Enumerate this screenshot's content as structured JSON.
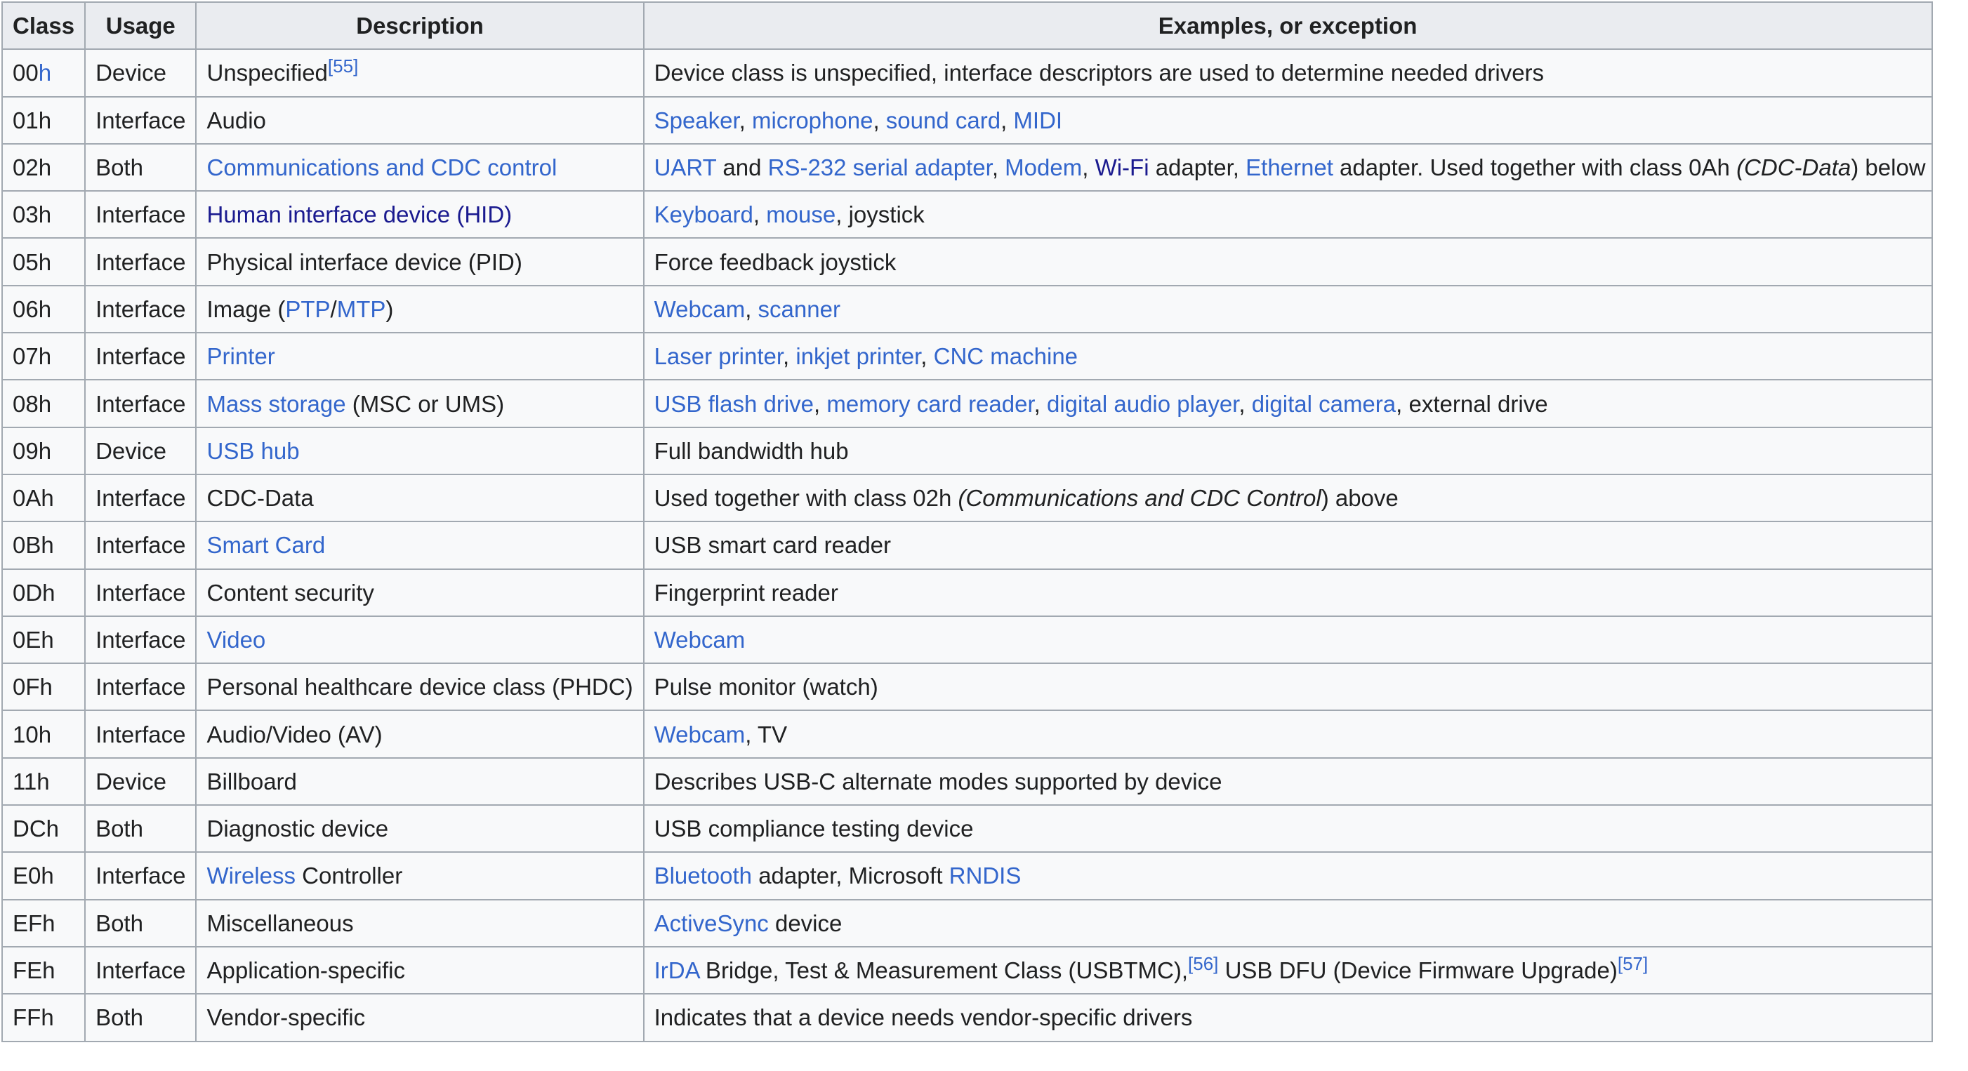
{
  "table": {
    "headers": [
      "Class",
      "Usage",
      "Description",
      "Examples, or exception"
    ],
    "rows": [
      {
        "class": [
          {
            "t": "00"
          },
          {
            "t": "h",
            "link": true
          }
        ],
        "usage": [
          {
            "t": "Device"
          }
        ],
        "description": [
          {
            "t": "Unspecified"
          },
          {
            "t": "[55]",
            "sup": true,
            "link": true
          }
        ],
        "examples": [
          {
            "t": "Device class is unspecified, interface descriptors are used to determine needed drivers"
          }
        ]
      },
      {
        "class": [
          {
            "t": "01h"
          }
        ],
        "usage": [
          {
            "t": "Interface"
          }
        ],
        "description": [
          {
            "t": "Audio"
          }
        ],
        "examples": [
          {
            "t": "Speaker",
            "link": true
          },
          {
            "t": ", "
          },
          {
            "t": "microphone",
            "link": true
          },
          {
            "t": ", "
          },
          {
            "t": "sound card",
            "link": true
          },
          {
            "t": ", "
          },
          {
            "t": "MIDI",
            "link": true
          }
        ]
      },
      {
        "class": [
          {
            "t": "02h"
          }
        ],
        "usage": [
          {
            "t": "Both"
          }
        ],
        "description": [
          {
            "t": "Communications and CDC control",
            "link": true
          }
        ],
        "examples": [
          {
            "t": "UART",
            "link": true
          },
          {
            "t": " and "
          },
          {
            "t": "RS-232 serial adapter",
            "link": true
          },
          {
            "t": ", "
          },
          {
            "t": "Modem",
            "link": true
          },
          {
            "t": ", "
          },
          {
            "t": "Wi-Fi",
            "link": true,
            "visited": true
          },
          {
            "t": " adapter, "
          },
          {
            "t": "Ethernet",
            "link": true
          },
          {
            "t": " adapter. Used together with class 0Ah "
          },
          {
            "t": "(CDC-Data",
            "italic": true
          },
          {
            "t": ") below"
          }
        ]
      },
      {
        "class": [
          {
            "t": "03h"
          }
        ],
        "usage": [
          {
            "t": "Interface"
          }
        ],
        "description": [
          {
            "t": "Human interface device (HID)",
            "link": true,
            "visited": true
          }
        ],
        "examples": [
          {
            "t": "Keyboard",
            "link": true
          },
          {
            "t": ", "
          },
          {
            "t": "mouse",
            "link": true
          },
          {
            "t": ", joystick"
          }
        ]
      },
      {
        "class": [
          {
            "t": "05h"
          }
        ],
        "usage": [
          {
            "t": "Interface"
          }
        ],
        "description": [
          {
            "t": "Physical interface device (PID)"
          }
        ],
        "examples": [
          {
            "t": "Force feedback joystick"
          }
        ]
      },
      {
        "class": [
          {
            "t": "06h"
          }
        ],
        "usage": [
          {
            "t": "Interface"
          }
        ],
        "description": [
          {
            "t": "Image ("
          },
          {
            "t": "PTP",
            "link": true
          },
          {
            "t": "/"
          },
          {
            "t": "MTP",
            "link": true
          },
          {
            "t": ")"
          }
        ],
        "examples": [
          {
            "t": "Webcam",
            "link": true
          },
          {
            "t": ", "
          },
          {
            "t": "scanner",
            "link": true
          }
        ]
      },
      {
        "class": [
          {
            "t": "07h"
          }
        ],
        "usage": [
          {
            "t": "Interface"
          }
        ],
        "description": [
          {
            "t": "Printer",
            "link": true
          }
        ],
        "examples": [
          {
            "t": "Laser printer",
            "link": true
          },
          {
            "t": ", "
          },
          {
            "t": "inkjet printer",
            "link": true
          },
          {
            "t": ", "
          },
          {
            "t": "CNC machine",
            "link": true
          }
        ]
      },
      {
        "class": [
          {
            "t": "08h"
          }
        ],
        "usage": [
          {
            "t": "Interface"
          }
        ],
        "description": [
          {
            "t": "Mass storage",
            "link": true
          },
          {
            "t": " (MSC or UMS)"
          }
        ],
        "examples": [
          {
            "t": "USB flash drive",
            "link": true
          },
          {
            "t": ", "
          },
          {
            "t": "memory card reader",
            "link": true
          },
          {
            "t": ", "
          },
          {
            "t": "digital audio player",
            "link": true
          },
          {
            "t": ", "
          },
          {
            "t": "digital camera",
            "link": true
          },
          {
            "t": ", external drive"
          }
        ]
      },
      {
        "class": [
          {
            "t": "09h"
          }
        ],
        "usage": [
          {
            "t": "Device"
          }
        ],
        "description": [
          {
            "t": "USB hub",
            "link": true
          }
        ],
        "examples": [
          {
            "t": "Full bandwidth hub"
          }
        ]
      },
      {
        "class": [
          {
            "t": "0Ah"
          }
        ],
        "usage": [
          {
            "t": "Interface"
          }
        ],
        "description": [
          {
            "t": "CDC-Data"
          }
        ],
        "examples": [
          {
            "t": "Used together with class 02h "
          },
          {
            "t": "(Communications and CDC Control",
            "italic": true
          },
          {
            "t": ") above"
          }
        ]
      },
      {
        "class": [
          {
            "t": "0Bh"
          }
        ],
        "usage": [
          {
            "t": "Interface"
          }
        ],
        "description": [
          {
            "t": "Smart Card",
            "link": true
          }
        ],
        "examples": [
          {
            "t": "USB smart card reader"
          }
        ]
      },
      {
        "class": [
          {
            "t": "0Dh"
          }
        ],
        "usage": [
          {
            "t": "Interface"
          }
        ],
        "description": [
          {
            "t": "Content security"
          }
        ],
        "examples": [
          {
            "t": "Fingerprint reader"
          }
        ]
      },
      {
        "class": [
          {
            "t": "0Eh"
          }
        ],
        "usage": [
          {
            "t": "Interface"
          }
        ],
        "description": [
          {
            "t": "Video",
            "link": true
          }
        ],
        "examples": [
          {
            "t": "Webcam",
            "link": true
          }
        ]
      },
      {
        "class": [
          {
            "t": "0Fh"
          }
        ],
        "usage": [
          {
            "t": "Interface"
          }
        ],
        "description": [
          {
            "t": "Personal healthcare device class (PHDC)"
          }
        ],
        "examples": [
          {
            "t": "Pulse monitor (watch)"
          }
        ]
      },
      {
        "class": [
          {
            "t": "10h"
          }
        ],
        "usage": [
          {
            "t": "Interface"
          }
        ],
        "description": [
          {
            "t": "Audio/Video (AV)"
          }
        ],
        "examples": [
          {
            "t": "Webcam",
            "link": true
          },
          {
            "t": ", TV"
          }
        ]
      },
      {
        "class": [
          {
            "t": "11h"
          }
        ],
        "usage": [
          {
            "t": "Device"
          }
        ],
        "description": [
          {
            "t": "Billboard"
          }
        ],
        "examples": [
          {
            "t": "Describes USB-C alternate modes supported by device"
          }
        ]
      },
      {
        "class": [
          {
            "t": "DCh"
          }
        ],
        "usage": [
          {
            "t": "Both"
          }
        ],
        "description": [
          {
            "t": "Diagnostic device"
          }
        ],
        "examples": [
          {
            "t": "USB compliance testing device"
          }
        ]
      },
      {
        "class": [
          {
            "t": "E0h"
          }
        ],
        "usage": [
          {
            "t": "Interface"
          }
        ],
        "description": [
          {
            "t": "Wireless",
            "link": true
          },
          {
            "t": " Controller"
          }
        ],
        "examples": [
          {
            "t": "Bluetooth",
            "link": true
          },
          {
            "t": " adapter, Microsoft "
          },
          {
            "t": "RNDIS",
            "link": true
          }
        ]
      },
      {
        "class": [
          {
            "t": "EFh"
          }
        ],
        "usage": [
          {
            "t": "Both"
          }
        ],
        "description": [
          {
            "t": "Miscellaneous"
          }
        ],
        "examples": [
          {
            "t": "ActiveSync",
            "link": true
          },
          {
            "t": " device"
          }
        ]
      },
      {
        "class": [
          {
            "t": "FEh"
          }
        ],
        "usage": [
          {
            "t": "Interface"
          }
        ],
        "description": [
          {
            "t": "Application-specific"
          }
        ],
        "examples": [
          {
            "t": "IrDA",
            "link": true
          },
          {
            "t": " Bridge, Test & Measurement Class (USBTMC),"
          },
          {
            "t": "[56]",
            "sup": true,
            "link": true
          },
          {
            "t": " USB DFU (Device Firmware Upgrade)"
          },
          {
            "t": "[57]",
            "sup": true,
            "link": true
          }
        ]
      },
      {
        "class": [
          {
            "t": "FFh"
          }
        ],
        "usage": [
          {
            "t": "Both"
          }
        ],
        "description": [
          {
            "t": "Vendor-specific"
          }
        ],
        "examples": [
          {
            "t": "Indicates that a device needs vendor-specific drivers"
          }
        ]
      }
    ]
  },
  "colors": {
    "link": "#3366cc",
    "link_visited": "#1a1a8f",
    "text": "#202122",
    "header_bg": "#eaecf0",
    "cell_bg": "#f8f9fa",
    "border": "#a2a9b1"
  }
}
